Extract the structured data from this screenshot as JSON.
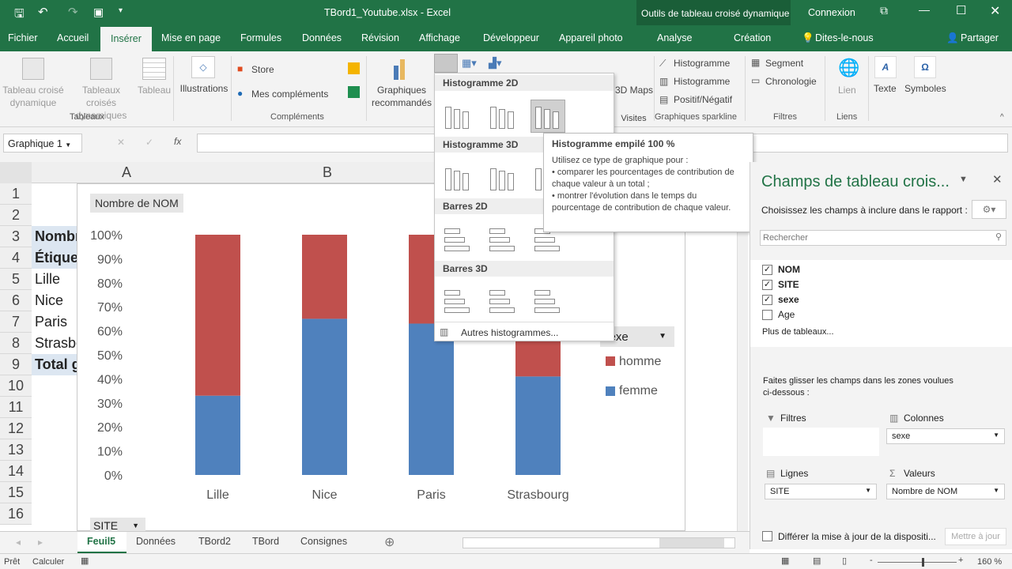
{
  "title": {
    "file": "TBord1_Youtube.xlsx - Excel",
    "context": "Outils de tableau croisé dynamique",
    "signin": "Connexion"
  },
  "tabs": [
    "Fichier",
    "Accueil",
    "Insérer",
    "Mise en page",
    "Formules",
    "Données",
    "Révision",
    "Affichage",
    "Développeur",
    "Appareil photo",
    "Analyse",
    "Création"
  ],
  "tell_me": "Dites-le-nous",
  "share": "Partager",
  "ribbon": {
    "pivot": "Tableau croisé dynamique",
    "pivot2": "Tableaux croisés dynamiques",
    "table": "Tableau",
    "group_tables": "Tableaux",
    "illustrations": "Illustrations",
    "store": "Store",
    "addins": "Mes compléments",
    "group_addins": "Compléments",
    "recommended": "Graphiques recommandés",
    "maps": "3D Maps",
    "group_tours": "Visites",
    "spark_line": "Histogramme",
    "spark_col": "Histogramme",
    "spark_wl": "Positif/Négatif",
    "group_spark": "Graphiques sparkline",
    "slicer": "Segment",
    "timeline": "Chronologie",
    "group_filters": "Filtres",
    "link": "Lien",
    "group_links": "Liens",
    "text": "Texte",
    "symbols": "Symboles"
  },
  "formula": {
    "namebox": "Graphique 1",
    "fx": "fx"
  },
  "columns": [
    "A",
    "B"
  ],
  "rows": [
    "1",
    "2",
    "3",
    "4",
    "5",
    "6",
    "7",
    "8",
    "9",
    "10",
    "11",
    "12",
    "13",
    "14",
    "15",
    "16"
  ],
  "cells": {
    "r3": "Nombre de NOM",
    "r4": "Étiquettes de lignes",
    "r5": "Lille",
    "r6": "Nice",
    "r7": "Paris",
    "r8": "Strasbourg",
    "r9": "Total général"
  },
  "chart_data": {
    "type": "bar",
    "stacked": "100%",
    "categories": [
      "Lille",
      "Nice",
      "Paris",
      "Strasbourg"
    ],
    "series": [
      {
        "name": "femme",
        "values": [
          33,
          65,
          63,
          41
        ],
        "color": "#4f81bd"
      },
      {
        "name": "homme",
        "values": [
          67,
          35,
          37,
          59
        ],
        "color": "#c0504d"
      }
    ],
    "yticks": [
      "0%",
      "10%",
      "20%",
      "30%",
      "40%",
      "50%",
      "60%",
      "70%",
      "80%",
      "90%",
      "100%"
    ],
    "ylim": [
      0,
      100
    ],
    "field_button": "Nombre de NOM",
    "axis_button": "SITE",
    "legend_button": "sexe",
    "legend": "right"
  },
  "gallery": {
    "h2d": "Histogramme 2D",
    "h3d": "Histogramme 3D",
    "b2d": "Barres 2D",
    "b3d": "Barres 3D",
    "more": "Autres histogrammes..."
  },
  "tooltip": {
    "title": "Histogramme empilé 100 %",
    "body": "Utilisez ce type de graphique pour :",
    "b1": "• comparer les pourcentages de contribution de chaque valeur à un total ;",
    "b2": "• montrer l'évolution dans le temps du pourcentage de contribution de chaque valeur."
  },
  "pane": {
    "title": "Champs de tableau crois...",
    "subtitle": "Choisissez les champs à inclure dans le rapport :",
    "search": "Rechercher",
    "fields": [
      {
        "name": "NOM",
        "checked": true
      },
      {
        "name": "SITE",
        "checked": true
      },
      {
        "name": "sexe",
        "checked": true
      },
      {
        "name": "Age",
        "checked": false
      }
    ],
    "more": "Plus de tableaux...",
    "drag": "Faites glisser les champs dans les zones voulues ci-dessous :",
    "filters": "Filtres",
    "columns": "Colonnes",
    "rows": "Lignes",
    "values": "Valeurs",
    "col_val": "sexe",
    "row_val": "SITE",
    "val_val": "Nombre de NOM",
    "defer": "Différer la mise à jour de la dispositi...",
    "update": "Mettre à jour"
  },
  "sheets": [
    "Feuil5",
    "Données",
    "TBord2",
    "TBord",
    "Consignes"
  ],
  "status": {
    "ready": "Prêt",
    "calc": "Calculer",
    "zoom": "160 %"
  }
}
